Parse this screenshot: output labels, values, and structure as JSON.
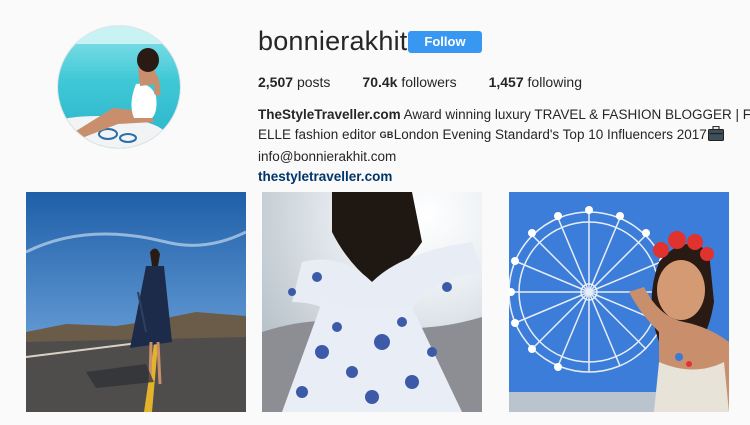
{
  "profile": {
    "username": "bonnierakhit",
    "follow_label": "Follow",
    "avatar_icon": "profile-photo"
  },
  "stats": {
    "posts_count": "2,507",
    "posts_label": "posts",
    "followers_count": "70.4k",
    "followers_label": "followers",
    "following_count": "1,457",
    "following_label": "following"
  },
  "bio": {
    "name": "TheStyleTraveller.com",
    "line1_rest": "Award winning luxury TRAVEL & FASHION BLOGGER | Former",
    "line2_start": "ELLE fashion editor",
    "flag": "GB",
    "line2_rest": "London Evening Standard's Top 10 Influencers 2017",
    "briefcase_icon": "briefcase-emoji",
    "email": "info@bonnierakhit.com",
    "website": "thestyletraveller.com"
  },
  "posts": [
    {
      "icon": "road-photo"
    },
    {
      "icon": "dress-photo"
    },
    {
      "icon": "ferris-wheel-photo"
    }
  ],
  "colors": {
    "follow_button": "#3897f0",
    "link": "#003569",
    "background": "#fafafa",
    "text": "#262626"
  }
}
